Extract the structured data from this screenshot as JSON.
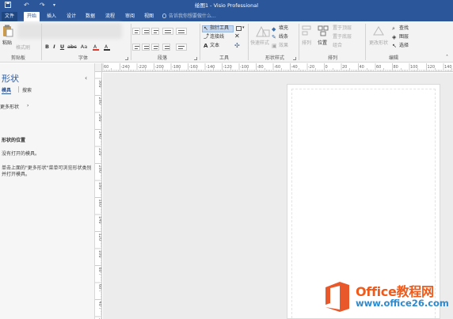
{
  "window": {
    "title": "绘图1 - Visio Professional"
  },
  "menu": {
    "tabs": [
      {
        "label": "文件"
      },
      {
        "label": "开始"
      },
      {
        "label": "插入"
      },
      {
        "label": "设计"
      },
      {
        "label": "数据"
      },
      {
        "label": "流程"
      },
      {
        "label": "审阅"
      },
      {
        "label": "视图"
      }
    ],
    "tell_me": "告诉我你想要做什么..."
  },
  "ribbon": {
    "clipboard": {
      "paste": "粘贴",
      "format_painter": "格式刷",
      "label": "剪贴板"
    },
    "font": {
      "bold": "B",
      "italic": "I",
      "underline": "U",
      "strike": "abc",
      "font_size": "Aa",
      "label": "字体"
    },
    "paragraph": {
      "label": "段落"
    },
    "tools": {
      "pointer": "指针工具",
      "connector": "连接线",
      "text": "文本",
      "label": "工具"
    },
    "shape_styles": {
      "quick_styles": "快速样式",
      "fill": "填充",
      "line": "线条",
      "effects": "效果",
      "label": "形状样式"
    },
    "arrange": {
      "align": "排列",
      "position": "位置",
      "bring_front": "置于顶层",
      "send_back": "置于底层",
      "group": "组合",
      "label": "排列"
    },
    "editing": {
      "change_shape": "更改形状",
      "find": "查找",
      "layers": "图层",
      "select": "选择",
      "label": "编辑"
    }
  },
  "shapes_pane": {
    "title": "形状",
    "tab_stencils": "模具",
    "tab_search": "搜索",
    "more_shapes": "更多形状",
    "section_heading": "形状的位置",
    "no_stencils": "没有打开的模具。",
    "hint": "单击上面的\"更多形状\"菜单可浏览形状类别并打开模具。"
  },
  "rulers": {
    "top_labels": [
      "60",
      "-240",
      "-220",
      "-200",
      "-180",
      "-160",
      "-140",
      "-120",
      "-100",
      "-80",
      "-60",
      "-40",
      "-20",
      "0",
      "20",
      "40",
      "60",
      "80",
      "100",
      "120",
      "140"
    ],
    "left_labels": [
      "300",
      "280",
      "260",
      "240",
      "220",
      "200",
      "180",
      "160",
      "140",
      "120",
      "100",
      "80",
      "60",
      "40",
      "20"
    ]
  },
  "watermark": {
    "title": "Office教程网",
    "url": "www.office26.com"
  },
  "colors": {
    "titlebar": "#2b579a",
    "canvas": "#ececec",
    "watermark_orange": "#f05a1a",
    "watermark_blue": "#2a8bd0"
  }
}
